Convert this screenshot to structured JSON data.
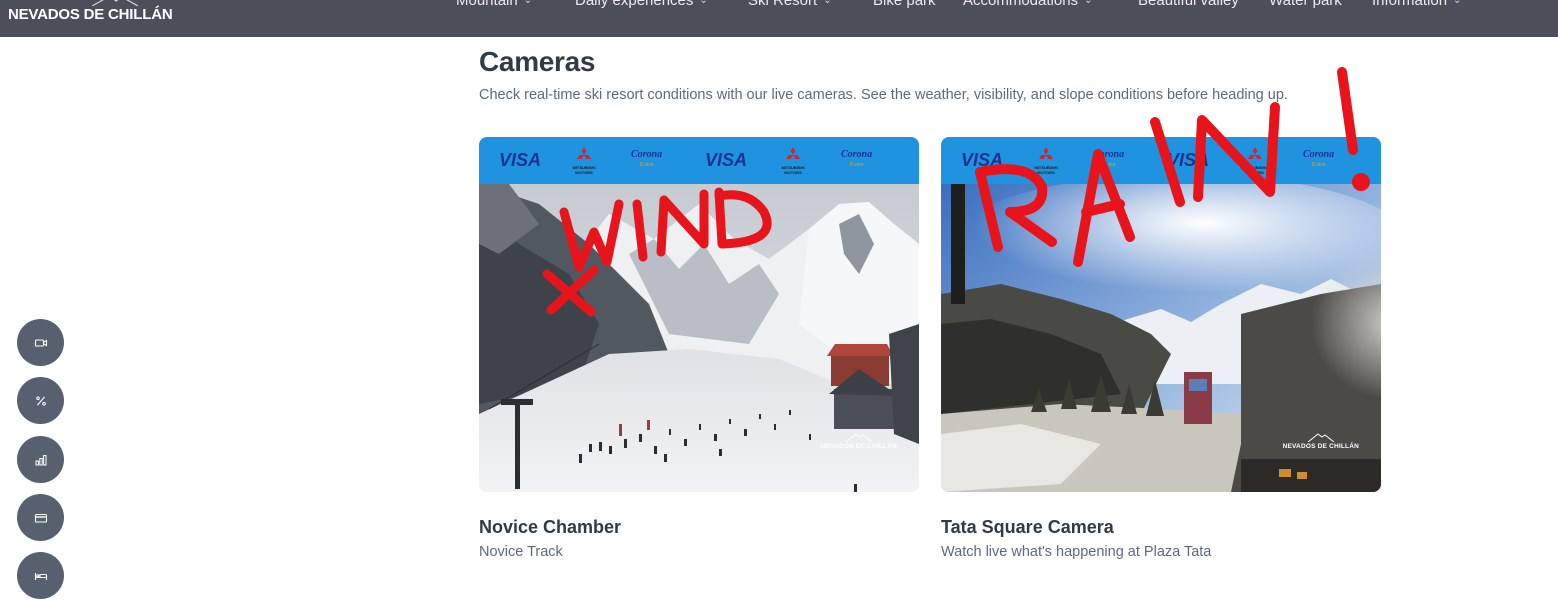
{
  "brand": {
    "logo_text": "NEVADOS DE CHILLÁN"
  },
  "nav": {
    "items": [
      {
        "label": "Mountain",
        "has_dropdown": true
      },
      {
        "label": "Daily experiences",
        "has_dropdown": true
      },
      {
        "label": "Ski Resort",
        "has_dropdown": true
      },
      {
        "label": "Bike park",
        "has_dropdown": false
      },
      {
        "label": "Accommodations",
        "has_dropdown": true
      },
      {
        "label": "Beautiful valley",
        "has_dropdown": false
      },
      {
        "label": "Water park",
        "has_dropdown": false
      },
      {
        "label": "Information",
        "has_dropdown": true
      }
    ]
  },
  "side_actions": [
    {
      "icon": "video-camera-icon"
    },
    {
      "icon": "percent-icon"
    },
    {
      "icon": "bar-chart-icon"
    },
    {
      "icon": "credit-card-icon"
    },
    {
      "icon": "bed-icon"
    }
  ],
  "page": {
    "title": "Cameras",
    "subtitle": "Check real-time ski resort conditions with our live cameras. See the weather, visibility, and slope conditions before heading up."
  },
  "sponsors": {
    "visa": "VISA",
    "corona_top": "Corona",
    "corona_bottom": "Extra",
    "mitsubishi": "MITSUBISHI MOTORS"
  },
  "cameras": [
    {
      "name": "Novice Chamber",
      "description": "Novice Track",
      "watermark": "NEVADOS DE CHILLÁN",
      "annotation": {
        "word": "WIND",
        "mark": "×"
      }
    },
    {
      "name": "Tata Square Camera",
      "description": "Watch live what's happening at Plaza Tata",
      "watermark": "NEVADOS DE CHILLÁN",
      "annotation": {
        "word": "RAIN!"
      }
    }
  ],
  "colors": {
    "topbar": "#4b4f5a",
    "sponsor_banner": "#1f93df",
    "annotation_red": "#e8141c",
    "fab": "#56606e"
  }
}
